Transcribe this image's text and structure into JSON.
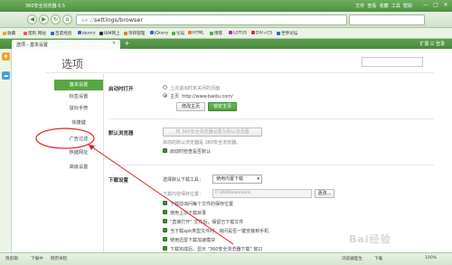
{
  "window": {
    "title": "360安全浏览器 6.5",
    "right_links": [
      "文件",
      "查看",
      "收藏",
      "工具",
      "帮助"
    ],
    "minimize": "—",
    "maximize": "□",
    "close": "✕"
  },
  "address": {
    "protocol": "se://",
    "url": "settings/browser"
  },
  "bookmarks": {
    "label": "收藏",
    "items": [
      "猎狗 网站",
      "百度经验",
      "jquery",
      "IBM网上",
      "项目管理",
      "jQuery",
      "论坛",
      "HTML",
      "博客",
      "LOTUS",
      "DIV+CS",
      "世界论坛"
    ]
  },
  "tab": {
    "label": "选项 - 基本设置",
    "close": "✕",
    "new": "+",
    "tools": "扩展  ☰ 登录"
  },
  "page": {
    "title": "选项",
    "menu": [
      "基本设置",
      "标签设置",
      "鼠标手势",
      "快捷键",
      "广告过滤",
      "热键网址",
      "高级设置"
    ],
    "startup": {
      "title": "启动时打开",
      "option1": "上次退出时未关闭的页面",
      "option2": "主页",
      "homepage": "http://www.baidu.com/",
      "modify_btn": "修改主页",
      "lock_btn": "锁定主页"
    },
    "default_browser": {
      "title": "默认浏览器",
      "set_btn": "将 360安全浏览器设置为默认浏览器",
      "status": "目前的默认浏览器是 360安全浏览器。",
      "check": "启动时检查是否默认"
    },
    "download": {
      "title": "下载设置",
      "tool_label": "选择默认下载工具：",
      "tool_value": "使用内置下载",
      "path_label": "下载内容保存位置：",
      "path_value": "F:\\360Downloads",
      "change_btn": "更改...",
      "options": [
        "下载前询问每个文件的保存位置",
        "使用上次下载目录",
        "\"直接打开\" 文件后，保留已下载文件",
        "当下载apk类型文件时，询问是否一键安装到手机",
        "使用迅雷下载加速模块",
        "下载完成后，显示 \"360安全浏览器下载\" 窗口"
      ]
    }
  },
  "status": {
    "left": [
      "快剪辑",
      "下载中",
      "网页体检"
    ],
    "right": [
      "浏览器医生",
      "下载",
      "100%"
    ]
  },
  "watermark": "Bai经验",
  "accent_color": "#57a842"
}
